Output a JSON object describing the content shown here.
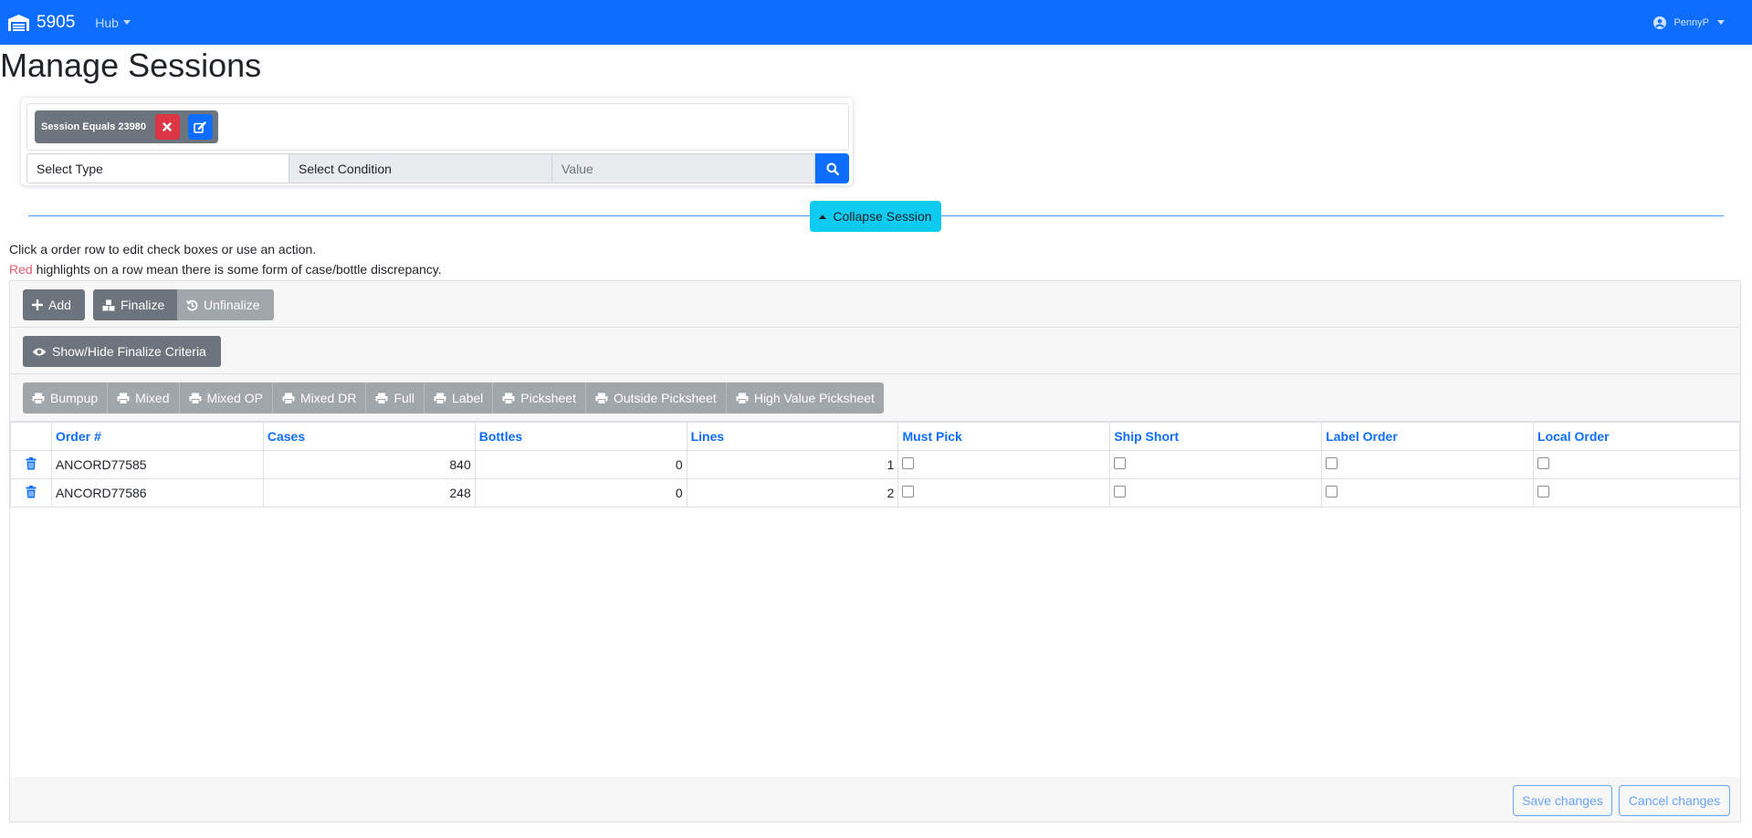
{
  "navbar": {
    "brand": "5905",
    "hub_label": "Hub",
    "user": "PennyP"
  },
  "page": {
    "title": "Manage Sessions"
  },
  "filter": {
    "chip_label": "Session Equals 23980",
    "type_label": "Select Type",
    "condition_label": "Select Condition",
    "value_placeholder": "Value"
  },
  "collapse_label": "Collapse Session",
  "info": {
    "line1": "Click a order row to edit check boxes or use an action.",
    "red_word": "Red",
    "line2_rest": " highlights on a row mean there is some form of case/bottle discrepancy."
  },
  "toolbar": {
    "add": "Add",
    "finalize": "Finalize",
    "unfinalize": "Unfinalize",
    "show_hide": "Show/Hide Finalize Criteria",
    "print_buttons": [
      "Bumpup",
      "Mixed",
      "Mixed OP",
      "Mixed DR",
      "Full",
      "Label",
      "Picksheet",
      "Outside Picksheet",
      "High Value Picksheet"
    ]
  },
  "table": {
    "columns": [
      "Order #",
      "Cases",
      "Bottles",
      "Lines",
      "Must Pick",
      "Ship Short",
      "Label Order",
      "Local Order"
    ],
    "rows": [
      {
        "order": "ANCORD77585",
        "cases": "840",
        "bottles": "0",
        "lines": "1"
      },
      {
        "order": "ANCORD77586",
        "cases": "248",
        "bottles": "0",
        "lines": "2"
      }
    ]
  },
  "footer": {
    "save": "Save changes",
    "cancel": "Cancel changes"
  },
  "colors": {
    "primary": "#0d6efd",
    "info": "#0dcaf0",
    "danger": "#dc3545",
    "secondary": "#6c757d"
  }
}
